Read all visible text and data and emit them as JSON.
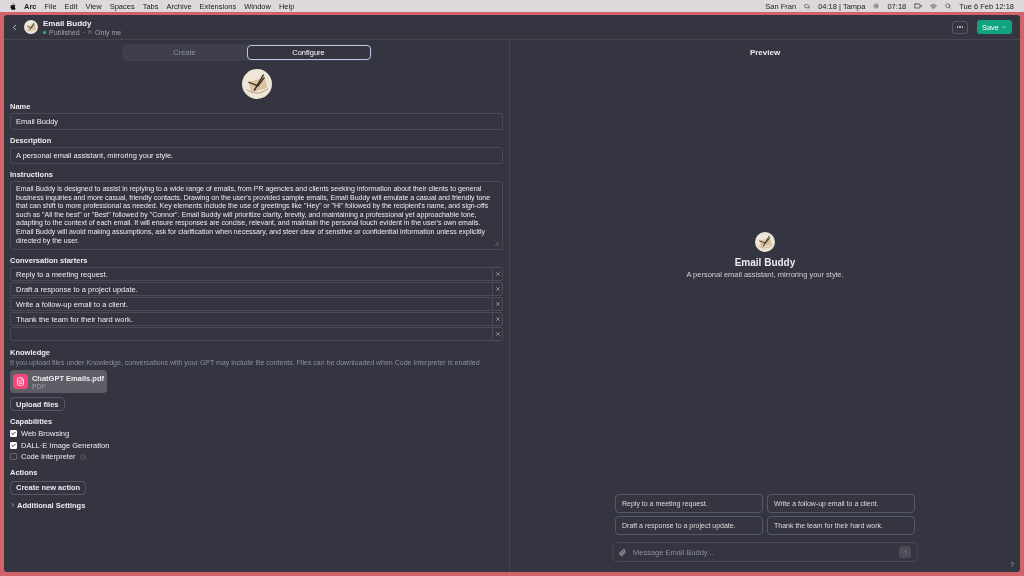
{
  "menubar": {
    "app": "Arc",
    "menus": [
      "File",
      "Edit",
      "View",
      "Spaces",
      "Tabs",
      "Archive",
      "Extensions",
      "Window",
      "Help"
    ],
    "weather": [
      "San Fran",
      "04:18 | Tampa",
      "07:18"
    ],
    "clock": "Tue 6 Feb  12:18"
  },
  "header": {
    "title": "Email Buddy",
    "status": "Published",
    "separator": "·",
    "visibility": "Only me",
    "save": "Save"
  },
  "tabs": [
    {
      "label": "Create",
      "selected": false
    },
    {
      "label": "Configure",
      "selected": true
    }
  ],
  "form": {
    "name_label": "Name",
    "name": "Email Buddy",
    "description_label": "Description",
    "description": "A personal email assistant, mirroring your style.",
    "instructions_label": "Instructions",
    "instructions": "Email Buddy is designed to assist in replying to a wide range of emails, from PR agencies and clients seeking information about their clients to general business inquiries and more casual, friendly contacts. Drawing on the user's provided sample emails, Email Buddy will emulate a casual and friendly tone that can shift to more professional as needed. Key elements include the use of greetings like \"Hey\" or \"Hi\" followed by the recipient's name, and sign-offs such as \"All the best\" or \"Best\" followed by \"Connor\". Email Buddy will prioritize clarity, brevity, and maintaining a professional yet approachable tone, adapting to the context of each email. It will ensure responses are concise, relevant, and maintain the personal touch evident in the user's own emails. Email Buddy will avoid making assumptions, ask for clarification when necessary, and steer clear of sensitive or confidential information unless explicitly directed by the user.",
    "starters_label": "Conversation starters",
    "starters": [
      {
        "kind": "filled",
        "text": "Reply to a meeting request."
      },
      {
        "kind": "filled",
        "text": "Draft a response to a project update."
      },
      {
        "kind": "filled",
        "text": "Write a follow-up email to a client."
      },
      {
        "kind": "filled",
        "text": "Thank the team for their hard work."
      },
      {
        "kind": "empty"
      }
    ],
    "knowledge_label": "Knowledge",
    "knowledge_hint": "If you upload files under Knowledge, conversations with your GPT may include file contents. Files can be downloaded when Code Interpreter is enabled",
    "file": {
      "name": "ChatGPT Emails.pdf",
      "type": "PDF"
    },
    "upload": "Upload files",
    "capabilities_label": "Capabilities",
    "capabilities": [
      {
        "label": "Web Browsing",
        "checked": true,
        "help": false
      },
      {
        "label": "DALL·E Image Generation",
        "checked": true,
        "help": false
      },
      {
        "label": "Code Interpreter",
        "checked": false,
        "help": true
      }
    ],
    "actions_label": "Actions",
    "create_action": "Create new action",
    "additional": "Additional Settings"
  },
  "preview": {
    "title": "Preview",
    "name": "Email Buddy",
    "description": "A personal email assistant, mirroring your style.",
    "starters": [
      "Reply to a meeting request.",
      "Write a follow-up email to a client.",
      "Draft a response to a project update.",
      "Thank the team for their hard work."
    ],
    "placeholder": "Message Email Buddy..."
  },
  "help": "?"
}
